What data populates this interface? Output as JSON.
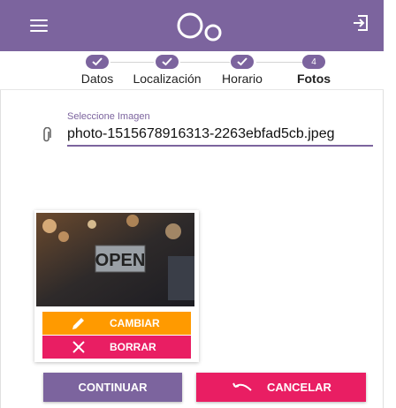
{
  "colors": {
    "primary": "#7c649e",
    "accent_orange": "#ff9a00",
    "accent_pink": "#e91e63"
  },
  "header": {
    "menu_icon": "hamburger-menu-icon",
    "logo_icon": "bubbles-logo-icon",
    "logout_icon": "sign-out-icon"
  },
  "stepper": {
    "steps": [
      {
        "label": "Datos",
        "state": "done",
        "indicator": ""
      },
      {
        "label": "Localización",
        "state": "done",
        "indicator": ""
      },
      {
        "label": "Horario",
        "state": "done",
        "indicator": ""
      },
      {
        "label": "Fotos",
        "state": "active",
        "indicator": "4"
      }
    ]
  },
  "upload": {
    "label": "Seleccione Imagen",
    "value": "photo-1515678916313-2263ebfad5cb.jpeg",
    "attach_icon": "paperclip-icon"
  },
  "image_card": {
    "photo_sign_text": "OPEN",
    "change_label": "CAMBIAR",
    "change_icon": "pencil-icon",
    "delete_label": "BORRAR",
    "delete_icon": "close-icon"
  },
  "actions": {
    "continue_label": "CONTINUAR",
    "cancel_label": "CANCELAR",
    "cancel_icon": "undo-icon"
  }
}
